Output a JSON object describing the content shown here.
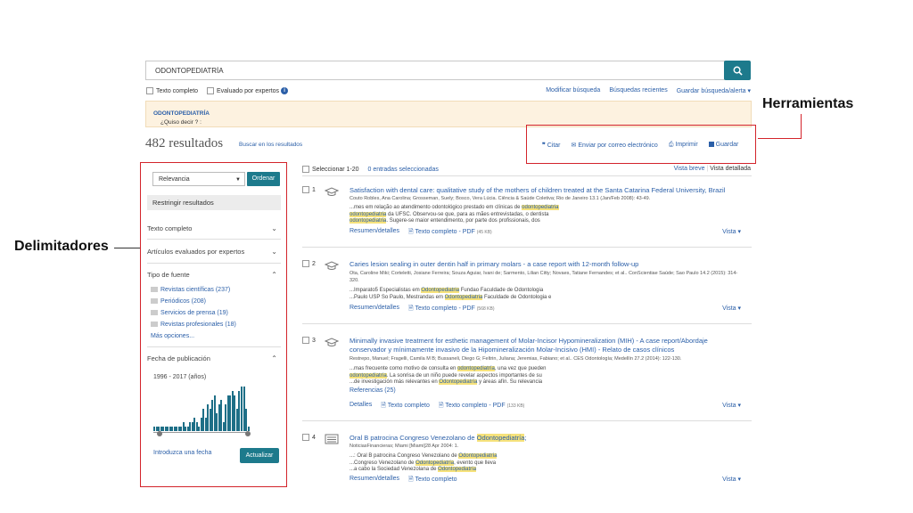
{
  "search": {
    "query": "ODONTOPEDIATRÍA",
    "placeholder": ""
  },
  "options": {
    "full_text": "Texto completo",
    "peer_reviewed": "Evaluado por expertos"
  },
  "toplinks": {
    "modify": "Modificar búsqueda",
    "recent": "Búsquedas recientes",
    "save": "Guardar búsqueda/alerta ▾"
  },
  "didyoumean": {
    "prefix": "¿Quiso decir ? :",
    "suggestion": "ODONTOPEDIATRÍA"
  },
  "results": {
    "count": "482 resultados",
    "search_within": "Buscar en los resultados"
  },
  "tools": {
    "cite": "Citar",
    "email": "Enviar por correo electrónico",
    "print": "Imprimir",
    "save": "Guardar"
  },
  "annotations": {
    "tools": "Herramientas",
    "limiters": "Delimitadores"
  },
  "sidebar": {
    "sort": "Relevancia",
    "sort_button": "Ordenar",
    "restrict": "Restringir resultados",
    "full_text": "Texto completo",
    "peer": "Artículos evaluados por expertos",
    "source_type": "Tipo de fuente",
    "facets": [
      "Revistas científicas (237)",
      "Periódicos (208)",
      "Servicios de prensa (19)",
      "Revistas profesionales (18)"
    ],
    "more": "Más opciones...",
    "pub_date": "Fecha de publicación",
    "date_range": "1996 - 2017 (años)",
    "histogram": [
      1,
      1,
      1,
      1,
      1,
      1,
      1,
      1,
      1,
      1,
      1,
      1,
      1,
      2,
      1,
      1,
      2,
      2,
      3,
      2,
      1,
      3,
      5,
      3,
      6,
      5,
      7,
      8,
      4,
      6,
      7,
      2,
      6,
      8,
      8,
      9,
      8,
      5,
      9,
      10,
      10,
      5,
      1
    ],
    "enter_date": "Introduzca una fecha",
    "update": "Actualizar"
  },
  "header": {
    "select": "Seleccionar 1-20",
    "selected": "0 entradas seleccionadas",
    "brief": "Vista breve",
    "detailed": "Vista detallada"
  },
  "items": [
    {
      "num": "1",
      "title": "Satisfaction with dental care: qualitative study of the mothers of children treated at the Santa Catarina Federal University, Brazil",
      "authors": "Couto Robles, Ana Carolina; Grosseman, Suely; Bosco, Vera Lúcia. Ciência & Saúde Coletiva; Rio de Janeiro 13.1 (Jan/Feb 2008): 43-49.",
      "s1a": "...mes em relação ao atendimento odontológico prestado em clínicas de",
      "s1h": "odontopediatria",
      "s2h": "odontopediatria",
      "s2b": "da UFSC. Observou-se que, para as mães entrevistadas, o dentista",
      "s3h": "odontopediatria",
      "s3b": ". Sugere-se maior entendimento, por parte dos profissionais, dos",
      "l1": "Resumen/detalles",
      "l2": "Texto completo - PDF",
      "l2s": "(45 KB)",
      "vista": "Vista ▾"
    },
    {
      "num": "2",
      "title": "Caries lesion sealing in outer dentin half in primary molars - a case report with 12-month follow-up",
      "authors": "Ota, Caroline Miki; Corteletti, Josiane Ferreira; Souza Aguiar, Ivani de; Sarmento, Lilian Citty; Novaes, Tatiane Fernandes; et al.. ConScientiae Saúde; Sao Paulo 14.2 (2015): 314-320.",
      "s1a": "...Imparato5 Especialistas em",
      "s1h": "Odontopediatria",
      "s1b": "Fundao Faculdade de Odontologia",
      "s2a": "...Paulo USP So Paulo, Mestrandas em",
      "s2h": "Odontopediatria",
      "s2b": "Faculdade de Odontologia e",
      "l1": "Resumen/detalles",
      "l2": "Texto completo - PDF",
      "l2s": "(568 KB)",
      "vista": "Vista ▾"
    },
    {
      "num": "3",
      "title": "Minimally invasive treatment for esthetic management of Molar-Incisor Hypomineralization (MIH) - A case report/Abordaje conservador y mínimamente invasivo de la Hipomineralización Molar-Incisivo (HMI) - Relato de casos clínicos",
      "authors": "Restrepo, Manuel; Fragelli, Camila M B; Bussaneli, Diego G; Feltrin, Juliana; Jeremias, Fabiano; et al.. CES Odontología; Medellín 27.2 (2014): 122-130.",
      "s1a": "...mas frecuente como motivo de consulta en",
      "s1h": "odontopediatría",
      "s1b": ", una vez que pueden",
      "s2h": "odontopediatría",
      "s2b": ". La sonrisa de un niño puede revelar aspectos importantes de su",
      "s3a": "...de investigación más relevantes en",
      "s3h": "Odontopediatría",
      "s3b": "y áreas afín. Su relevancia",
      "refs": "Referencias (25)",
      "l0": "Detalles",
      "l1": "Texto completo",
      "l2": "Texto completo - PDF",
      "l2s": "(133 KB)",
      "vista": "Vista ▾"
    },
    {
      "num": "4",
      "title": "Oral B patrocina Congreso Venezolano de",
      "titleh": "Odontopediatría",
      "titlee": ";",
      "authors": "NoticiasFinancieras; Miami [Miami]28 Apr 2004: 1.",
      "s1a": "...: Oral B patrocina Congreso Venezolano de",
      "s1h": "Odontopediatría",
      "s2a": "...Congreso Venezolano de",
      "s2h": "Odontopediatría",
      "s2b": ", evento que lleva",
      "s3a": "...a cabo la Sociedad Venezolana de",
      "s3h": "Odontopediatría",
      "l1": "Resumen/detalles",
      "l2": "Texto completo",
      "vista": "Vista ▾"
    }
  ]
}
